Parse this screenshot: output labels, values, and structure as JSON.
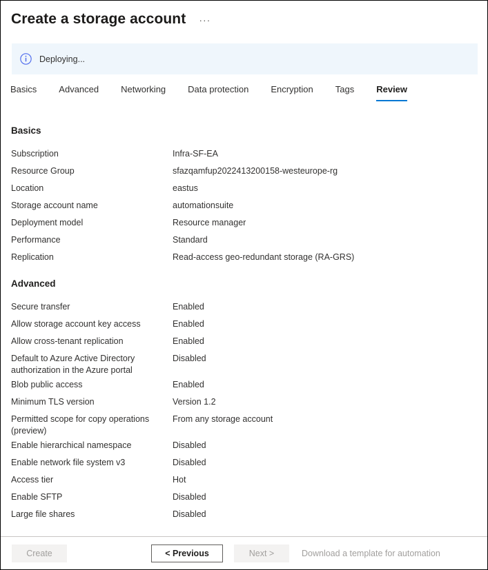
{
  "header": {
    "title": "Create a storage account",
    "ellipsis_label": "···"
  },
  "banner": {
    "icon": "info-circle-icon",
    "text": "Deploying...",
    "background_color": "#eff6fc",
    "icon_color": "#0078d4"
  },
  "tabs": {
    "selected": "Review",
    "accent_color": "#0078d4",
    "items": [
      {
        "label": "Basics"
      },
      {
        "label": "Advanced"
      },
      {
        "label": "Networking"
      },
      {
        "label": "Data protection"
      },
      {
        "label": "Encryption"
      },
      {
        "label": "Tags"
      },
      {
        "label": "Review"
      }
    ]
  },
  "sections": [
    {
      "heading": "Basics",
      "rows": [
        {
          "key": "Subscription",
          "value": "Infra-SF-EA"
        },
        {
          "key": "Resource Group",
          "value": "sfazqamfup2022413200158-westeurope-rg"
        },
        {
          "key": "Location",
          "value": "eastus"
        },
        {
          "key": "Storage account name",
          "value": "automationsuite"
        },
        {
          "key": "Deployment model",
          "value": "Resource manager"
        },
        {
          "key": "Performance",
          "value": "Standard"
        },
        {
          "key": "Replication",
          "value": "Read-access geo-redundant storage (RA-GRS)"
        }
      ]
    },
    {
      "heading": "Advanced",
      "rows": [
        {
          "key": "Secure transfer",
          "value": "Enabled"
        },
        {
          "key": "Allow storage account key access",
          "value": "Enabled"
        },
        {
          "key": "Allow cross-tenant replication",
          "value": "Enabled"
        },
        {
          "key": "Default to Azure Active Directory authorization in the Azure portal",
          "value": "Disabled"
        },
        {
          "key": "Blob public access",
          "value": "Enabled"
        },
        {
          "key": "Minimum TLS version",
          "value": "Version 1.2"
        },
        {
          "key": "Permitted scope for copy operations (preview)",
          "value": "From any storage account"
        },
        {
          "key": "Enable hierarchical namespace",
          "value": "Disabled"
        },
        {
          "key": "Enable network file system v3",
          "value": "Disabled"
        },
        {
          "key": "Access tier",
          "value": "Hot"
        },
        {
          "key": "Enable SFTP",
          "value": "Disabled"
        },
        {
          "key": "Large file shares",
          "value": "Disabled"
        }
      ]
    }
  ],
  "footer": {
    "create_label": "Create",
    "previous_label": "< Previous",
    "next_label": "Next >",
    "download_label": "Download a template for automation"
  }
}
